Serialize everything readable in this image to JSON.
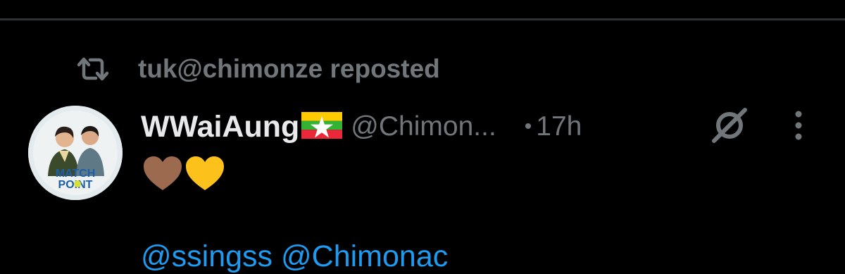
{
  "repost": {
    "icon": "repost-icon",
    "text": "tuk@chimonze reposted"
  },
  "post": {
    "author": {
      "display_name": "WWaiAung",
      "flag": "myanmar-flag",
      "handle": "@Chimon...",
      "avatar_text_line1": "MATCH",
      "avatar_text_line2": "POINT"
    },
    "separator": "•",
    "time": "17h",
    "grok_icon": "grok-icon",
    "more_icon": "more-vertical-icon",
    "emoji": [
      "brown-heart",
      "yellow-heart"
    ],
    "mentions": [
      "@ssingss",
      "@Chimonac"
    ]
  },
  "colors": {
    "background": "#000000",
    "primary_text": "#e7e9ea",
    "secondary_text": "#71767b",
    "link": "#1d9bf0",
    "divider": "#2f3336"
  }
}
